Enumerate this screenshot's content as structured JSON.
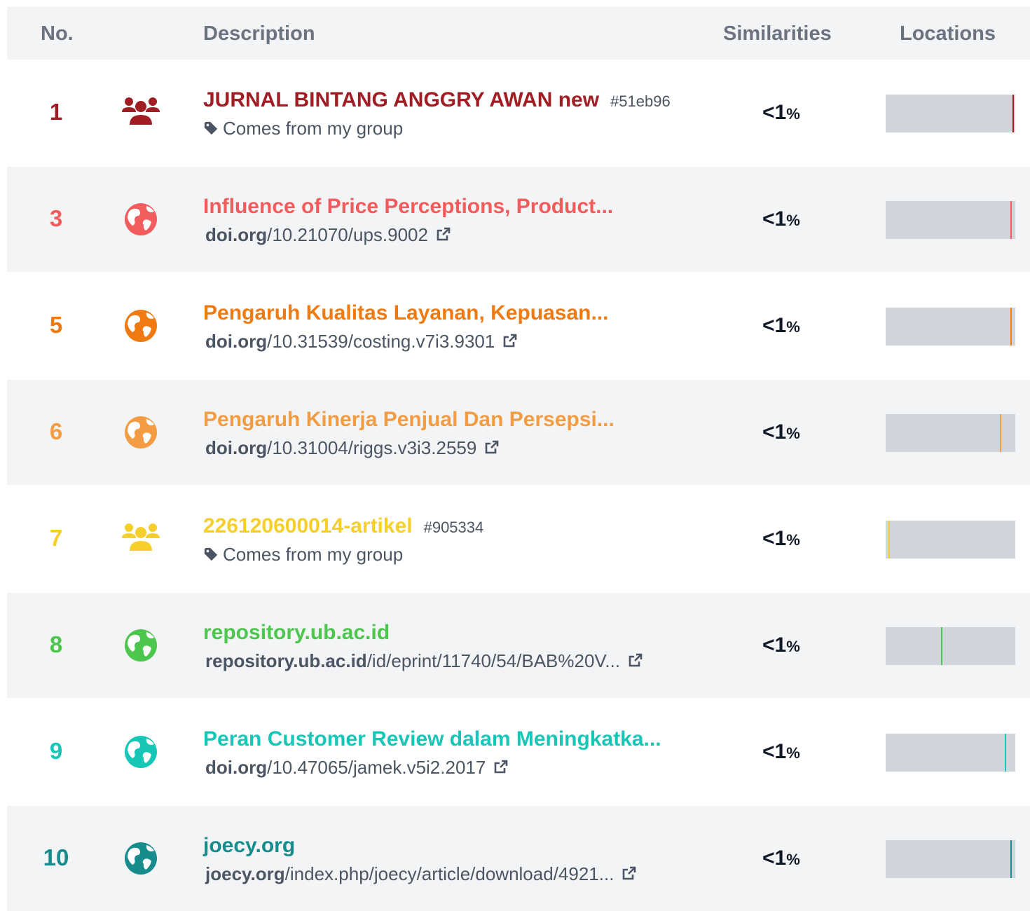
{
  "header": {
    "no": "No.",
    "description": "Description",
    "similarities": "Similarities",
    "locations": "Locations"
  },
  "rows": [
    {
      "no": "1",
      "type": "group",
      "color": "#a11d24",
      "title": "JURNAL BINTANG ANGGRY AWAN new",
      "hash": "#51eb96",
      "sub_kind": "group",
      "sub_text": "Comes from my group",
      "similarity": "<1",
      "pct": "%",
      "location_fraction": 0.99
    },
    {
      "no": "3",
      "type": "web",
      "color": "#f25c5c",
      "title": "Influence of Price Perceptions, Product...",
      "sub_kind": "link",
      "domain": "doi.org",
      "path": "/10.21070/ups.9002",
      "similarity": "<1",
      "pct": "%",
      "location_fraction": 0.975
    },
    {
      "no": "5",
      "type": "web",
      "color": "#f07a12",
      "title": "Pengaruh Kualitas Layanan, Kepuasan...",
      "sub_kind": "link",
      "domain": "doi.org",
      "path": "/10.31539/costing.v7i3.9301",
      "similarity": "<1",
      "pct": "%",
      "location_fraction": 0.975
    },
    {
      "no": "6",
      "type": "web",
      "color": "#f39c42",
      "title": "Pengaruh Kinerja Penjual Dan Persepsi...",
      "sub_kind": "link",
      "domain": "doi.org",
      "path": "/10.31004/riggs.v3i3.2559",
      "similarity": "<1",
      "pct": "%",
      "location_fraction": 0.89
    },
    {
      "no": "7",
      "type": "group",
      "color": "#f7cf2b",
      "title": "226120600014-artikel",
      "hash": "#905334",
      "sub_kind": "group",
      "sub_text": "Comes from my group",
      "similarity": "<1",
      "pct": "%",
      "location_fraction": 0.02
    },
    {
      "no": "8",
      "type": "web",
      "color": "#4cc64c",
      "title": "repository.ub.ac.id",
      "sub_kind": "link",
      "domain": "repository.ub.ac.id",
      "path": "/id/eprint/11740/54/BAB%20V...",
      "similarity": "<1",
      "pct": "%",
      "location_fraction": 0.43
    },
    {
      "no": "9",
      "type": "web",
      "color": "#18c6b8",
      "title": "Peran Customer Review dalam Meningkatka...",
      "sub_kind": "link",
      "domain": "doi.org",
      "path": "/10.47065/jamek.v5i2.2017",
      "similarity": "<1",
      "pct": "%",
      "location_fraction": 0.93
    },
    {
      "no": "10",
      "type": "web",
      "color": "#168c8c",
      "title": "joecy.org",
      "sub_kind": "link",
      "domain": "joecy.org",
      "path": "/index.php/joecy/article/download/4921...",
      "similarity": "<1",
      "pct": "%",
      "location_fraction": 0.975
    }
  ]
}
